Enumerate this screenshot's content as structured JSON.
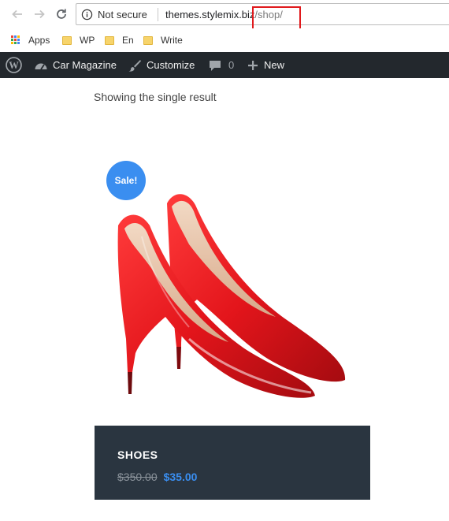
{
  "browser": {
    "security_label": "Not secure",
    "url_host": "themes.stylemix.biz",
    "url_path": "/shop/"
  },
  "bookmarks": [
    {
      "label": "Apps",
      "icon": "apps-grid-icon"
    },
    {
      "label": "WP",
      "icon": "folder-icon"
    },
    {
      "label": "En",
      "icon": "folder-icon"
    },
    {
      "label": "Write",
      "icon": "folder-icon"
    }
  ],
  "adminbar": {
    "site_name": "Car Magazine",
    "customize": "Customize",
    "comments_count": "0",
    "new_label": "New"
  },
  "shop": {
    "result_count": "Showing the single result",
    "sale_badge": "Sale!",
    "product": {
      "title": "SHOES",
      "price_old": "$350.00",
      "price_new": "$35.00"
    }
  },
  "colors": {
    "accent": "#3a8ef0",
    "adminbar_bg": "#23282d",
    "card_bg": "#2a3540",
    "highlight": "#e0191c",
    "shoe_red": "#e3151b"
  }
}
